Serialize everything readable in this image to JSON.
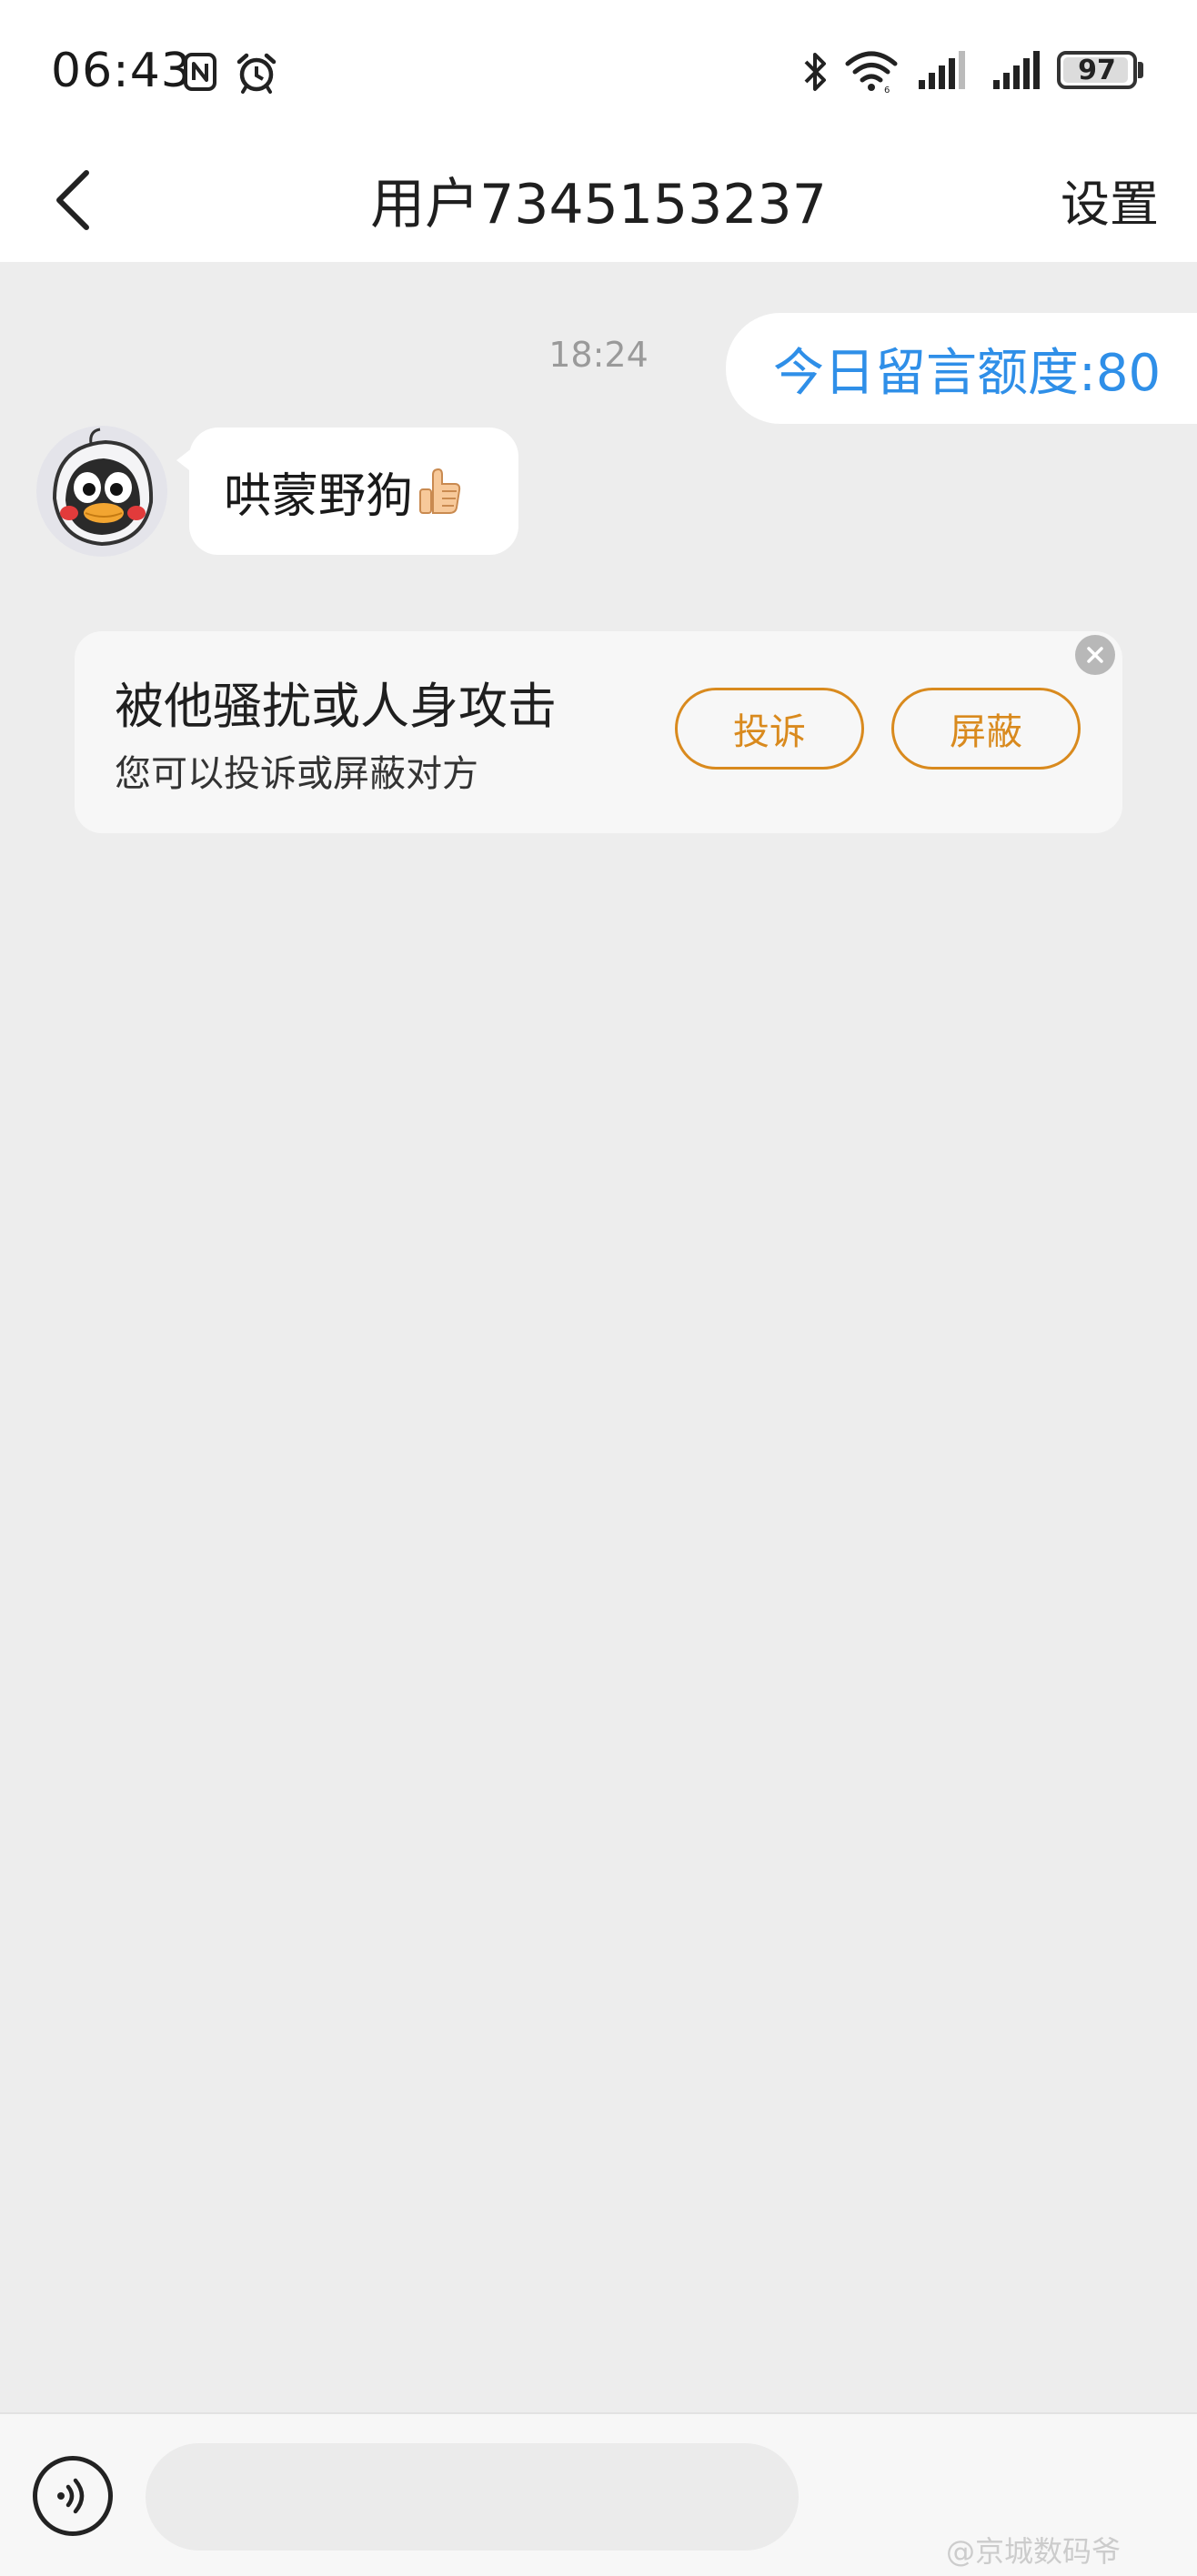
{
  "status_bar": {
    "time": "06:43",
    "battery": "97"
  },
  "header": {
    "title": "用户7345153237",
    "settings_label": "设置"
  },
  "chat": {
    "timestamp": "18:24",
    "quota_notice": "今日留言额度:80",
    "incoming_message": "哄蒙野狗"
  },
  "report_card": {
    "title": "被他骚扰或人身攻击",
    "subtitle": "您可以投诉或屏蔽对方",
    "complain_label": "投诉",
    "block_label": "屏蔽"
  },
  "watermark": "@京城数码爷",
  "colors": {
    "accent_blue": "#2f8fe8",
    "accent_orange": "#d98a1e",
    "chat_background": "#ededed"
  },
  "icons": [
    "back-arrow-icon",
    "nfc-icon",
    "alarm-icon",
    "bluetooth-icon",
    "wifi-icon",
    "signal-icon",
    "battery-icon",
    "thumbs-up-icon",
    "close-icon",
    "voice-icon"
  ]
}
